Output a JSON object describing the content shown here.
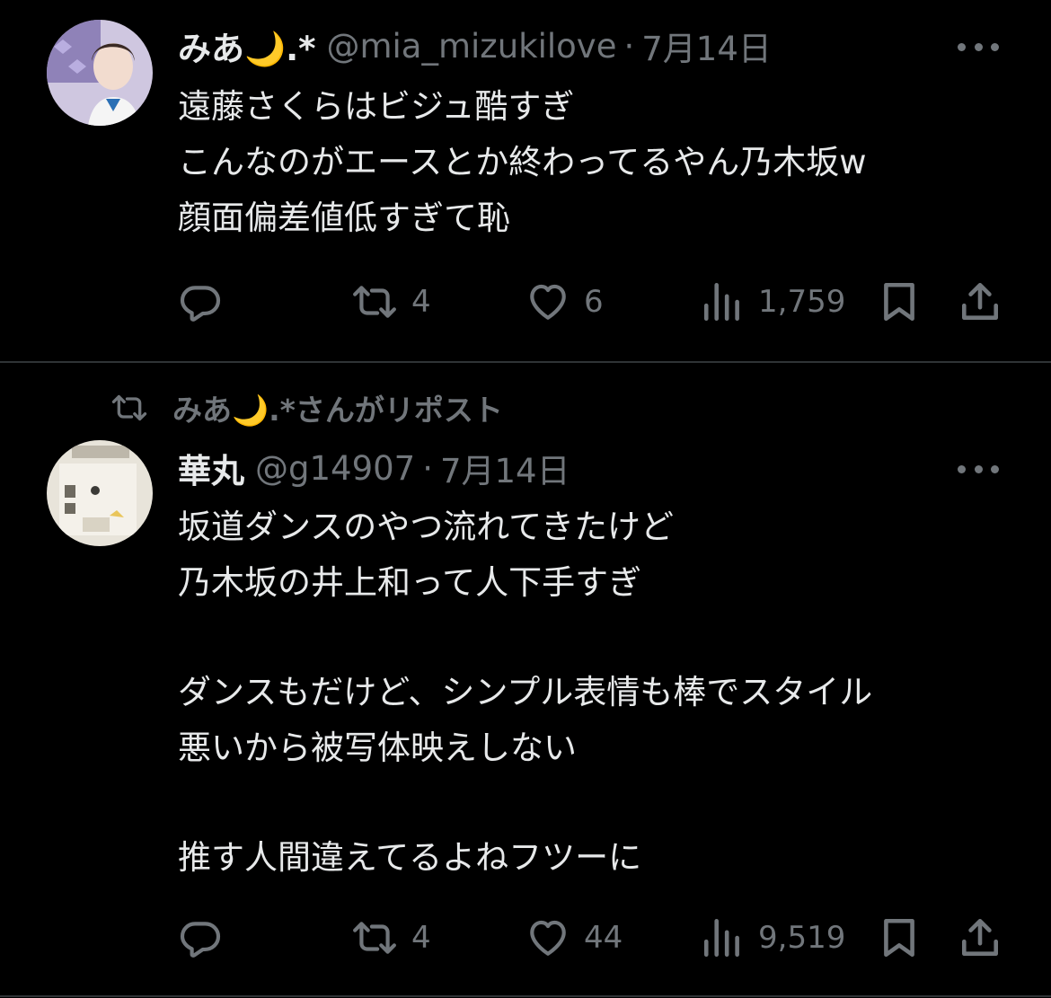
{
  "tweets": [
    {
      "display_name": "みあ🌙.*",
      "handle": "@mia_mizukilove",
      "separator": "·",
      "date": "7月14日",
      "lines": [
        "遠藤さくらはビジュ酷すぎ",
        "こんなのがエースとか終わってるやん乃木坂w",
        "顔面偏差値低すぎて恥"
      ],
      "reply_count": "",
      "repost_count": "4",
      "like_count": "6",
      "view_count": "1,759"
    },
    {
      "reposted_by": "みあ🌙.*さんがリポスト",
      "display_name": "華丸",
      "handle": "@g14907",
      "separator": "·",
      "date": "7月14日",
      "lines": [
        "坂道ダンスのやつ流れてきたけど",
        "乃木坂の井上和って人下手すぎ",
        "",
        "ダンスもだけど、シンプル表情も棒でスタイル",
        "悪いから被写体映えしない",
        "",
        "推す人間違えてるよねフツーに"
      ],
      "reply_count": "",
      "repost_count": "4",
      "like_count": "44",
      "view_count": "9,519"
    }
  ],
  "icons": {
    "reply": "reply-icon",
    "repost": "repost-icon",
    "like": "like-icon",
    "views": "views-icon",
    "bookmark": "bookmark-icon",
    "share": "share-icon",
    "more": "more-icon"
  },
  "colors": {
    "background": "#000000",
    "text": "#e7e9ea",
    "secondary": "#71767b",
    "divider": "#2f3336"
  }
}
